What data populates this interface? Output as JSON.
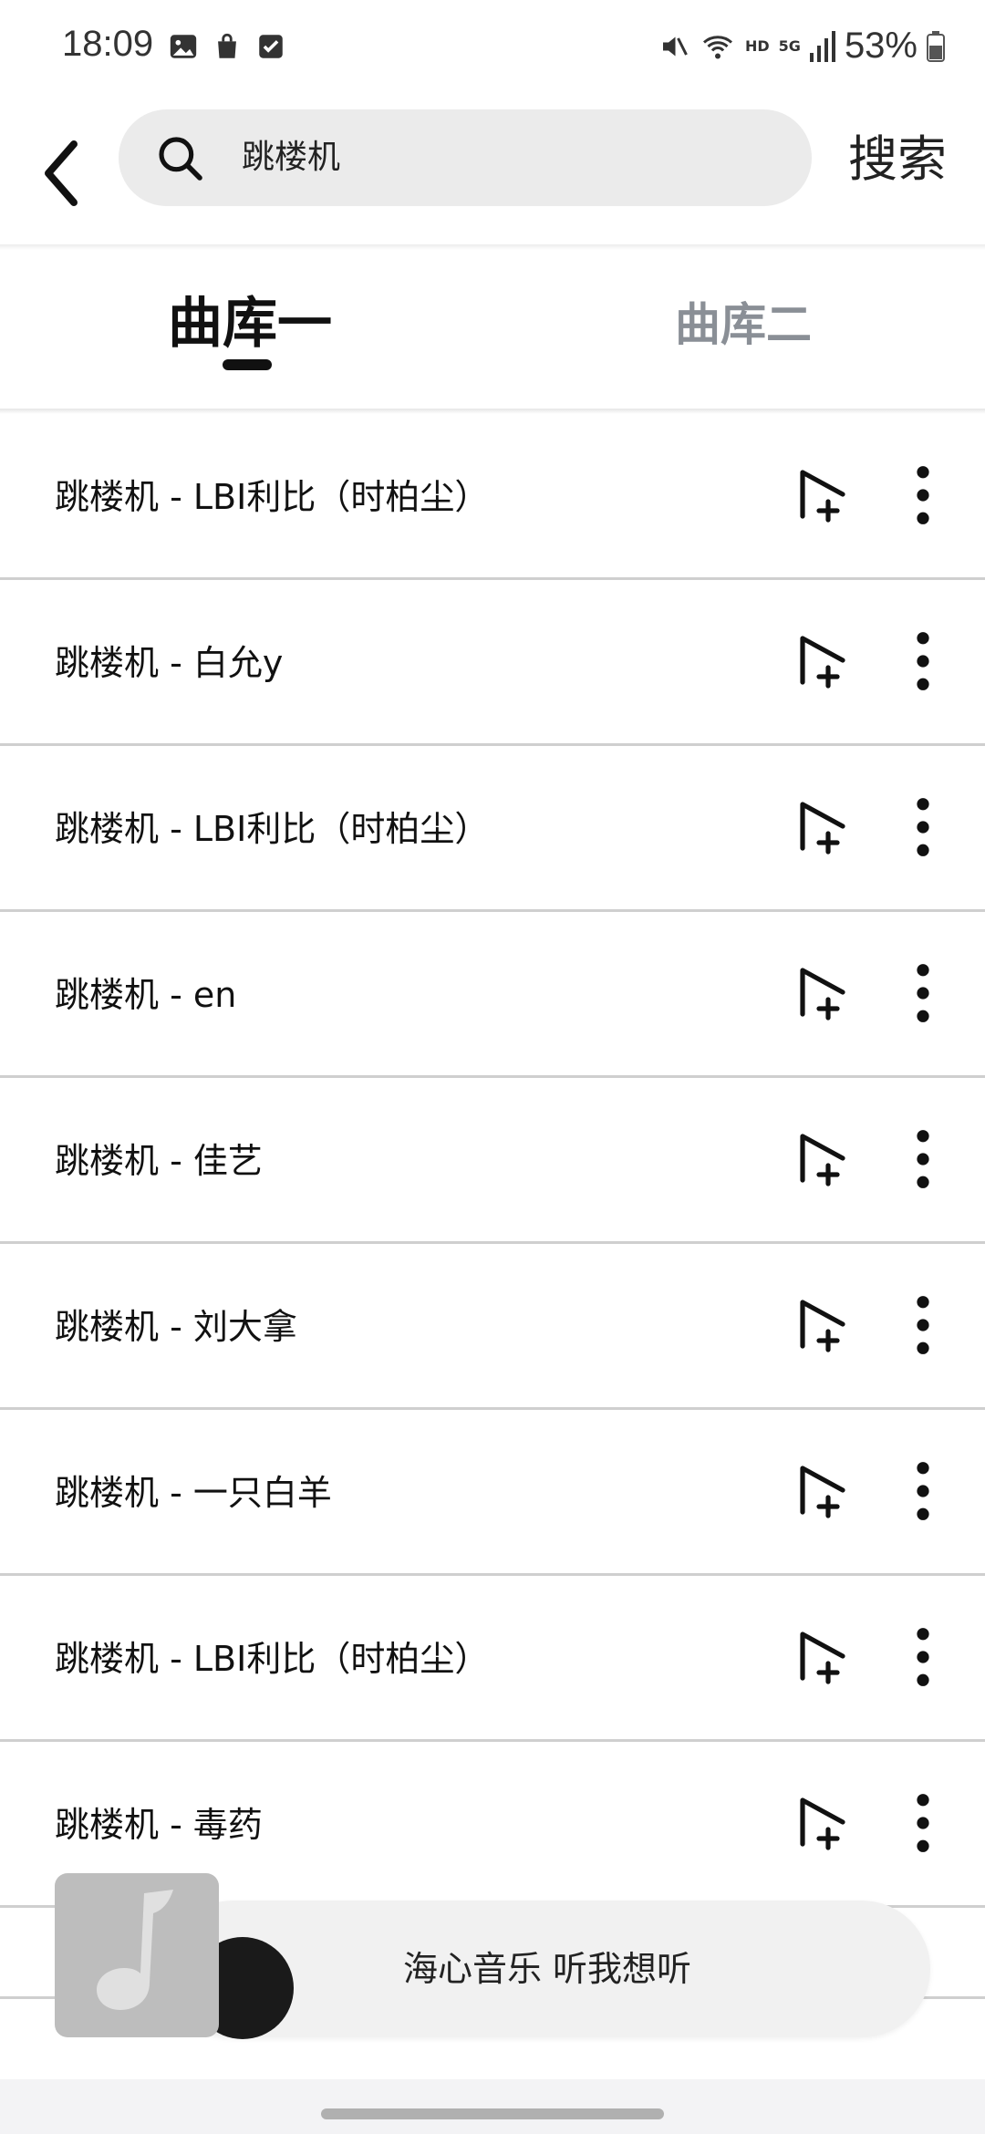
{
  "status_bar": {
    "time": "18:09",
    "network": "HD",
    "signal": "5G",
    "battery": "53%"
  },
  "header": {
    "search_value": "跳楼机",
    "search_button": "搜索"
  },
  "tabs": [
    {
      "label": "曲库一",
      "active": true
    },
    {
      "label": "曲库二",
      "active": false
    }
  ],
  "songs": [
    {
      "title": "跳楼机 - LBI利比（时柏尘）"
    },
    {
      "title": "跳楼机 - 白允y"
    },
    {
      "title": "跳楼机 - LBI利比（时柏尘）"
    },
    {
      "title": "跳楼机 - en"
    },
    {
      "title": "跳楼机 - 佳艺"
    },
    {
      "title": "跳楼机 - 刘大拿"
    },
    {
      "title": "跳楼机 - 一只白羊"
    },
    {
      "title": "跳楼机 - LBI利比（时柏尘）"
    },
    {
      "title": "跳楼机 - 毒药"
    }
  ],
  "player": {
    "title": "海心音乐 听我想听"
  },
  "icons": {
    "back": "back-arrow-icon",
    "search": "search-icon",
    "add_to_playlist": "add-to-playlist-icon",
    "more": "more-vertical-icon",
    "music_note": "music-note-icon"
  }
}
